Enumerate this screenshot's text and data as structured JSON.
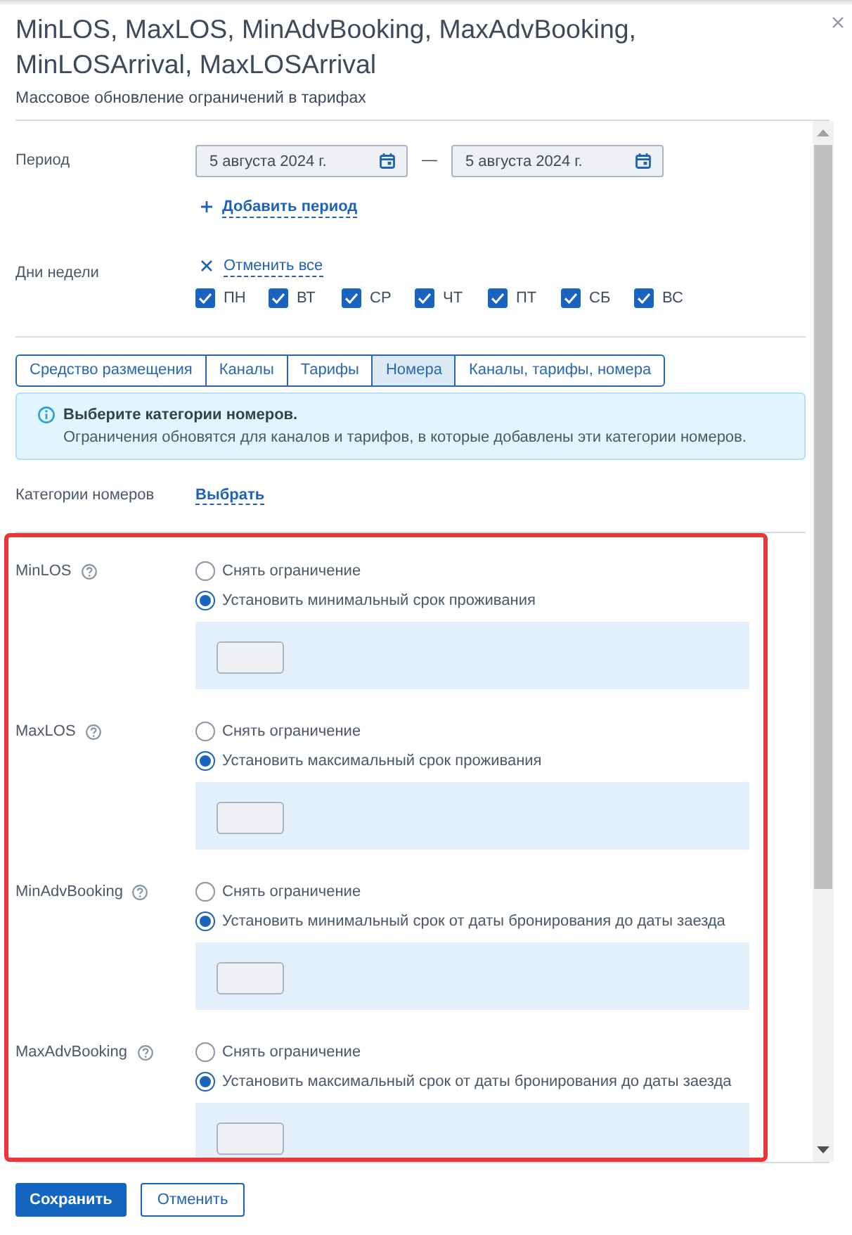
{
  "dialog": {
    "title": "MinLOS, MaxLOS, MinAdvBooking, MaxAdvBooking, MinLOSArrival, MaxLOSArrival",
    "subtitle": "Массовое обновление ограничений в тарифах"
  },
  "period": {
    "label": "Период",
    "ranges": [
      {
        "from": "5 августа 2024 г.",
        "separator": "—",
        "to": "5 августа 2024 г."
      }
    ],
    "add_link": "Добавить период"
  },
  "weekdays": {
    "label": "Дни недели",
    "clear_link": "Отменить все",
    "days": [
      {
        "label": "ПН",
        "checked": true
      },
      {
        "label": "ВТ",
        "checked": true
      },
      {
        "label": "СР",
        "checked": true
      },
      {
        "label": "ЧТ",
        "checked": true
      },
      {
        "label": "ПТ",
        "checked": true
      },
      {
        "label": "СБ",
        "checked": true
      },
      {
        "label": "ВС",
        "checked": true
      }
    ]
  },
  "tabs": [
    {
      "label": "Средство размещения",
      "selected": false
    },
    {
      "label": "Каналы",
      "selected": false
    },
    {
      "label": "Тарифы",
      "selected": false
    },
    {
      "label": "Номера",
      "selected": true
    },
    {
      "label": "Каналы, тарифы, номера",
      "selected": false
    }
  ],
  "alert": {
    "title": "Выберите категории номеров.",
    "text": "Ограничения обновятся для каналов и тарифов, в которые добавлены эти категории номеров."
  },
  "room_categories": {
    "label": "Категории номеров",
    "link": "Выбрать"
  },
  "restrictions_highlighted": true,
  "restrictions": [
    {
      "name": "MinLOS",
      "options": [
        {
          "label": "Снять ограничение",
          "selected": false
        },
        {
          "label": "Установить минимальный срок проживания",
          "selected": true
        }
      ]
    },
    {
      "name": "MaxLOS",
      "options": [
        {
          "label": "Снять ограничение",
          "selected": false
        },
        {
          "label": "Установить максимальный срок проживания",
          "selected": true
        }
      ]
    },
    {
      "name": "MinAdvBooking",
      "options": [
        {
          "label": "Снять ограничение",
          "selected": false
        },
        {
          "label": "Установить минимальный срок от даты бронирования до даты заезда",
          "selected": true
        }
      ]
    },
    {
      "name": "MaxAdvBooking",
      "options": [
        {
          "label": "Снять ограничение",
          "selected": false
        },
        {
          "label": "Установить максимальный срок от даты бронирования до даты заезда",
          "selected": true
        }
      ]
    }
  ],
  "buttons": [
    {
      "label": "Сохранить",
      "kind": "primary"
    },
    {
      "label": "Отменить",
      "kind": "secondary"
    }
  ]
}
